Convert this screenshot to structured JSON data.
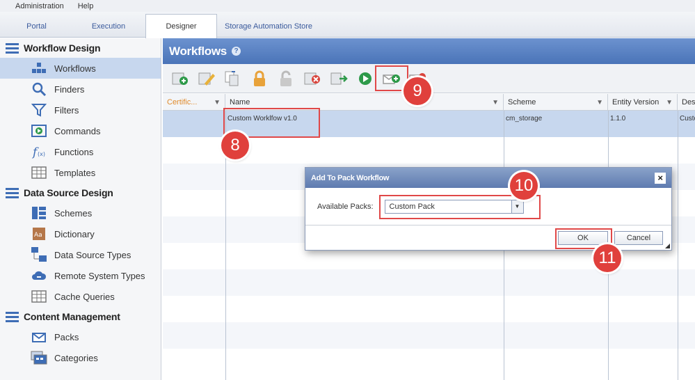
{
  "menu": {
    "items": [
      "Administration",
      "Help"
    ]
  },
  "tabs": [
    {
      "label": "Portal"
    },
    {
      "label": "Execution"
    },
    {
      "label": "Designer"
    },
    {
      "label": "Storage Automation Store"
    }
  ],
  "sidebar": {
    "sections": [
      {
        "title": "Workflow Design"
      },
      {
        "title": "Data Source Design"
      },
      {
        "title": "Content Management"
      }
    ],
    "items": [
      {
        "label": "Workflows"
      },
      {
        "label": "Finders"
      },
      {
        "label": "Filters"
      },
      {
        "label": "Commands"
      },
      {
        "label": "Functions"
      },
      {
        "label": "Templates"
      },
      {
        "label": "Schemes"
      },
      {
        "label": "Dictionary"
      },
      {
        "label": "Data Source Types"
      },
      {
        "label": "Remote System Types"
      },
      {
        "label": "Cache Queries"
      },
      {
        "label": "Packs"
      },
      {
        "label": "Categories"
      }
    ]
  },
  "main": {
    "title": "Workflows",
    "help_glyph": "?"
  },
  "grid": {
    "columns": [
      {
        "label": "Certific..."
      },
      {
        "label": "Name"
      },
      {
        "label": "Scheme"
      },
      {
        "label": "Entity Version"
      },
      {
        "label": "Desc"
      }
    ],
    "rows": [
      {
        "name": "Custom Worklfow v1.0",
        "scheme": "cm_storage",
        "version": "1.1.0",
        "desc": "Custo"
      }
    ]
  },
  "dialog": {
    "title": "Add To Pack Workflow",
    "close_glyph": "×",
    "field_label": "Available Packs:",
    "selected_pack": "Custom Pack",
    "ok_label": "OK",
    "cancel_label": "Cancel"
  },
  "annotations": {
    "step8": "8",
    "step9": "9",
    "step10": "10",
    "step11": "11"
  },
  "colors": {
    "header_blue": "#4a74b8",
    "selection": "#c7d7ee",
    "annotation_red": "#e0403c",
    "certificate_orange": "#e08a2b"
  }
}
